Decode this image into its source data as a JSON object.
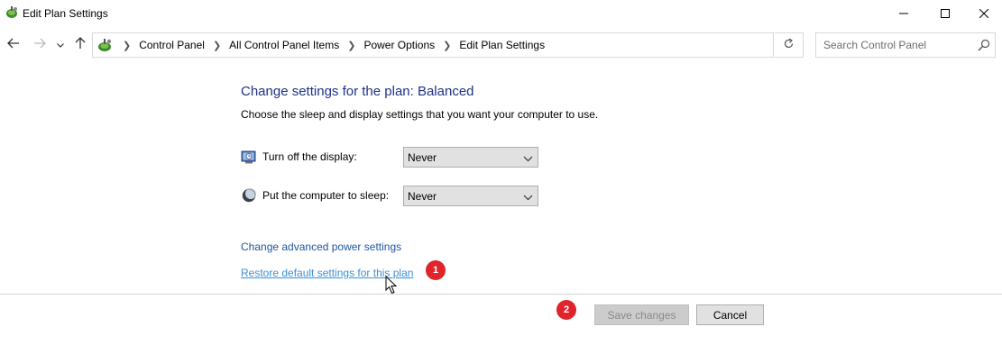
{
  "window": {
    "title": "Edit Plan Settings",
    "icon": "power-options-icon"
  },
  "navigation": {
    "breadcrumbs": [
      "Control Panel",
      "All Control Panel Items",
      "Power Options",
      "Edit Plan Settings"
    ],
    "search_placeholder": "Search Control Panel"
  },
  "content": {
    "heading": "Change settings for the plan: Balanced",
    "description": "Choose the sleep and display settings that you want your computer to use.",
    "settings": [
      {
        "label": "Turn off the display:",
        "value": "Never",
        "icon": "monitor-clock-icon"
      },
      {
        "label": "Put the computer to sleep:",
        "value": "Never",
        "icon": "moon-icon"
      }
    ],
    "links": {
      "advanced": "Change advanced power settings",
      "restore": "Restore default settings for this plan"
    }
  },
  "annotations": {
    "badge_1": "1",
    "badge_2": "2"
  },
  "buttons": {
    "save": "Save changes",
    "cancel": "Cancel"
  },
  "colors": {
    "heading": "#1e3287",
    "link": "#1e57a3",
    "badge": "#e0242b"
  }
}
